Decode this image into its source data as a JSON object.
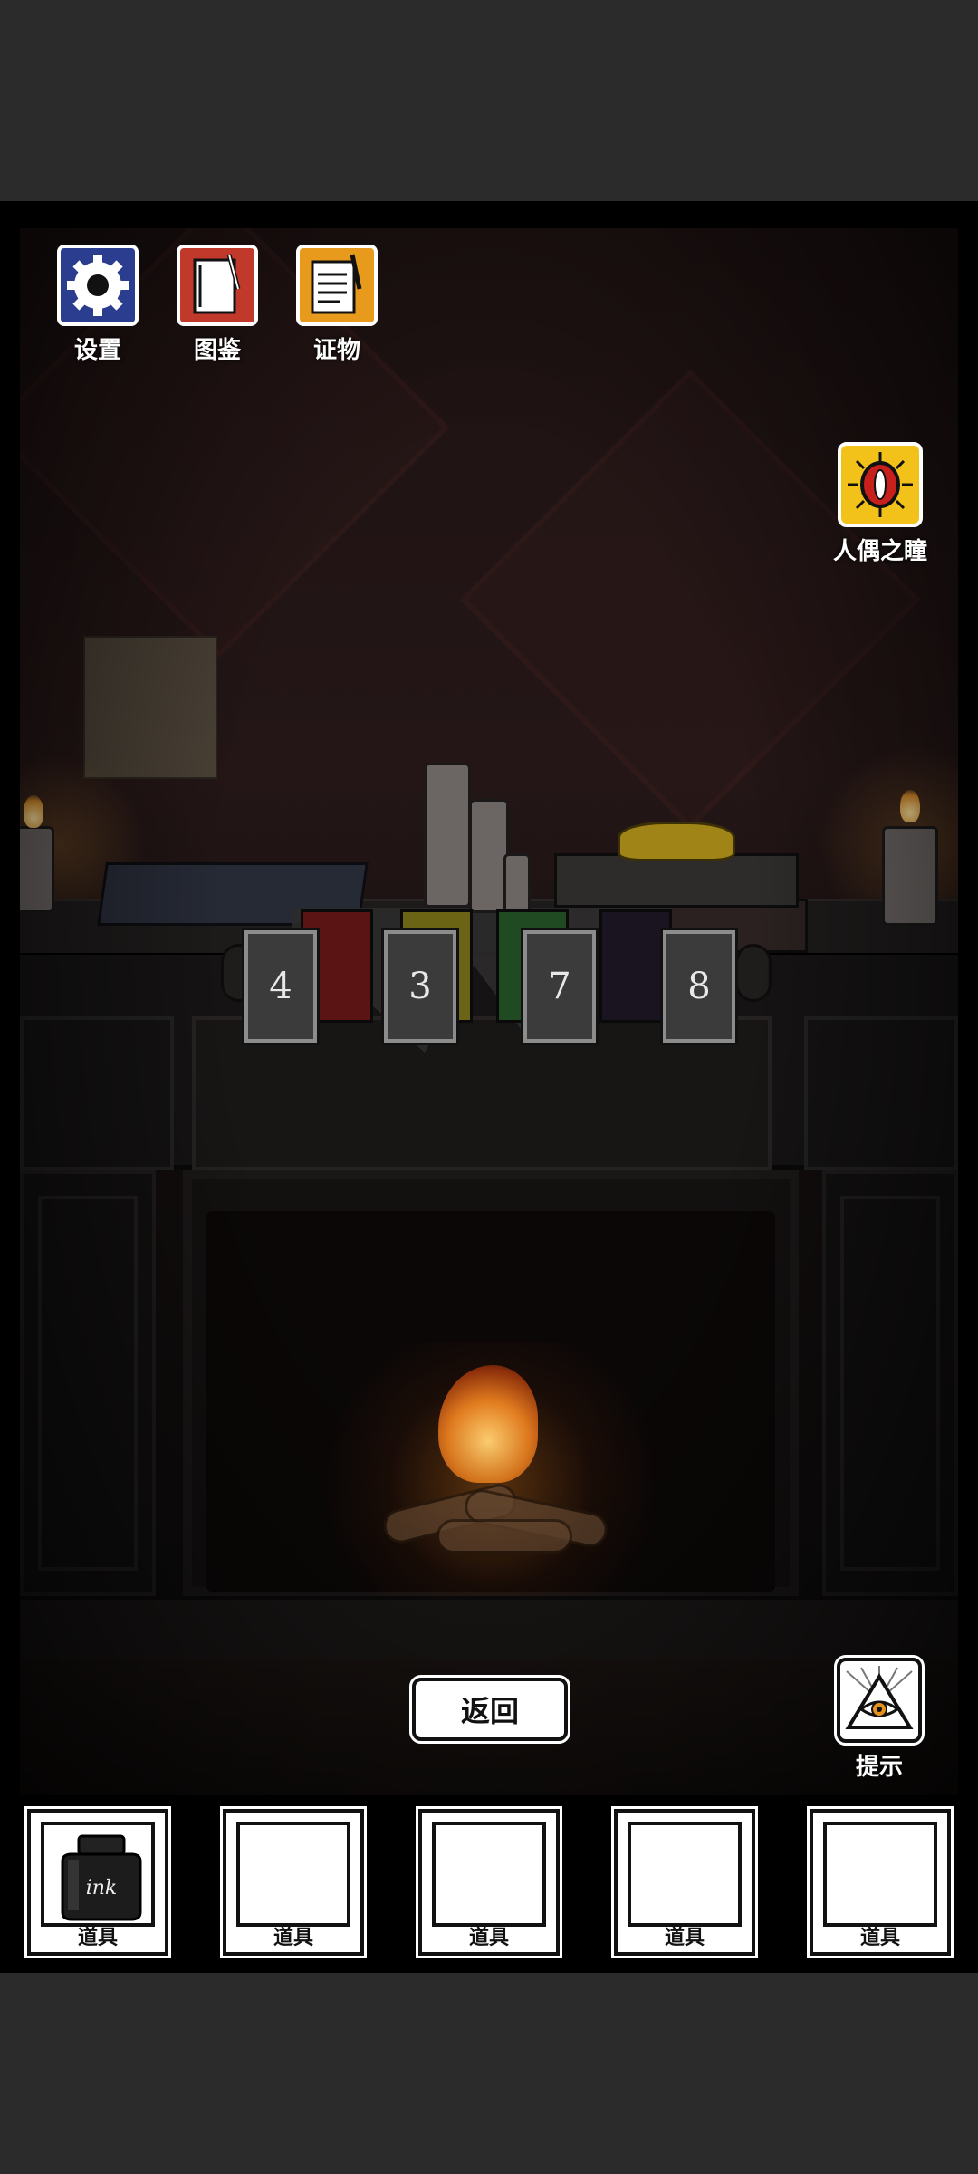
{
  "top_menu": [
    {
      "id": "settings",
      "label": "设置",
      "icon": "gear-icon",
      "color": "#2b3d8e"
    },
    {
      "id": "codex",
      "label": "图鉴",
      "icon": "notebook-pen-icon",
      "color": "#c0392b"
    },
    {
      "id": "evidence",
      "label": "证物",
      "icon": "notepad-pen-icon",
      "color": "#e89a1c"
    }
  ],
  "doll_eye": {
    "label": "人偶之瞳",
    "icon": "red-eye-icon",
    "color": "#f2c21a"
  },
  "hint": {
    "label": "提示",
    "icon": "all-seeing-eye-icon"
  },
  "back_label": "返回",
  "puzzle": {
    "numbers": [
      "4",
      "3",
      "7",
      "8"
    ],
    "color_slots": [
      "#5a1414",
      "#6b6415",
      "#1f4a22",
      "#1a1420"
    ]
  },
  "inventory": [
    {
      "label": "道具",
      "item": "ink",
      "item_text": "ink"
    },
    {
      "label": "道具",
      "item": ""
    },
    {
      "label": "道具",
      "item": ""
    },
    {
      "label": "道具",
      "item": ""
    },
    {
      "label": "道具",
      "item": ""
    }
  ]
}
